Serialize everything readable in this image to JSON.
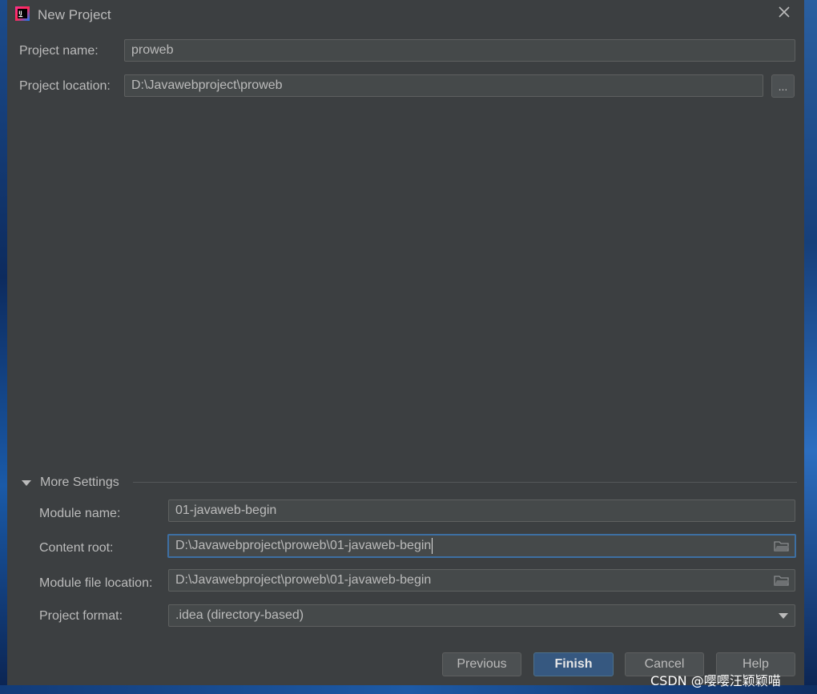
{
  "window": {
    "title": "New Project",
    "app_icon": "intellij-idea-icon",
    "close_icon": "close-icon"
  },
  "project": {
    "name_label": "Project name:",
    "name_value": "proweb",
    "location_label": "Project location:",
    "location_value": "D:\\Javawebproject\\proweb",
    "browse_label": "..."
  },
  "more_settings": {
    "label": "More Settings",
    "expanded": true,
    "module_name_label": "Module name:",
    "module_name_value": "01-javaweb-begin",
    "content_root_label": "Content root:",
    "content_root_value": "D:\\Javawebproject\\proweb\\01-javaweb-begin",
    "module_file_location_label": "Module file location:",
    "module_file_location_value": "D:\\Javawebproject\\proweb\\01-javaweb-begin",
    "project_format_label": "Project format:",
    "project_format_value": ".idea (directory-based)"
  },
  "buttons": {
    "previous": "Previous",
    "finish": "Finish",
    "cancel": "Cancel",
    "help": "Help"
  },
  "watermark": "CSDN @嘤嘤汪颖颖喵",
  "colors": {
    "dialog_bg": "#3c3f41",
    "field_bg": "#45494a",
    "focus_border": "#3d6fa3",
    "primary_button": "#365880",
    "text": "#bbbbbb"
  }
}
